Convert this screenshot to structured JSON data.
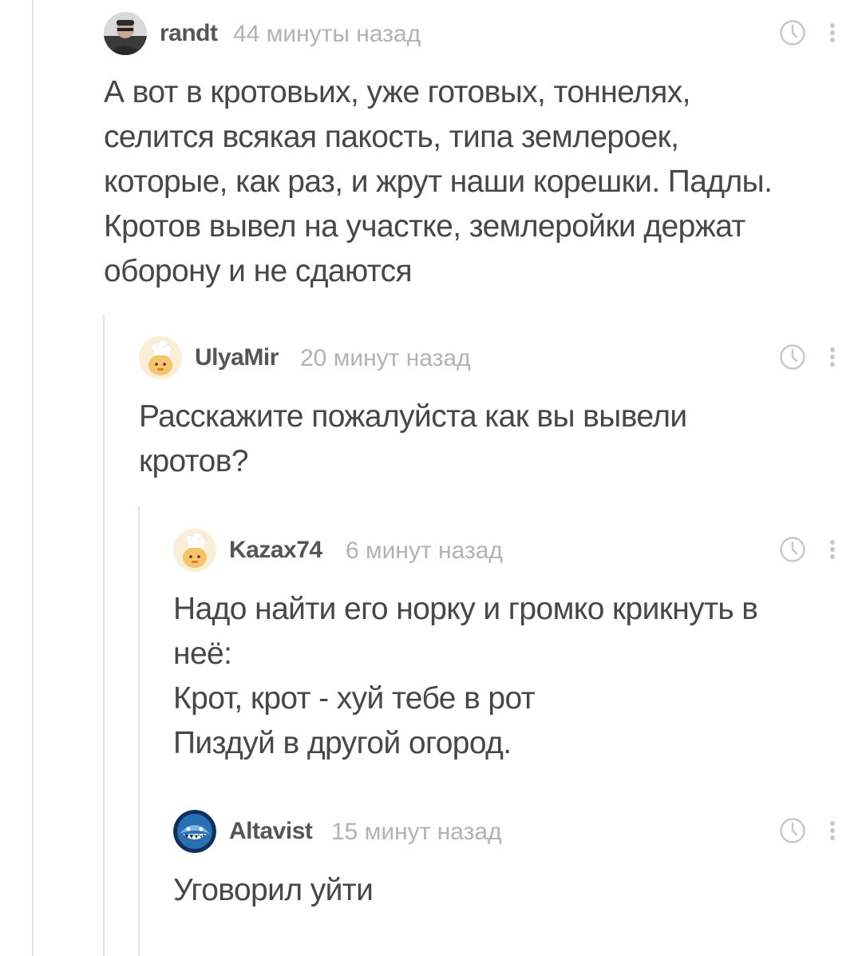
{
  "comments": [
    {
      "author": "randt",
      "time": "44 минуты назад",
      "avatar": "user-photo-avatar",
      "lines": [
        "А вот в кротовьих, уже готовых, тоннелях,",
        "селится всякая пакость, типа землероек,",
        "которые, как раз, и жрут наши корешки. Падлы.",
        "Кротов вывел на участке, землеройки держат",
        "оборону и не сдаются"
      ]
    },
    {
      "author": "UlyaMir",
      "time": "20 минут назад",
      "avatar": "default-chef-avatar",
      "lines": [
        "Расскажите пожалуйста как вы вывели",
        "кротов?"
      ]
    },
    {
      "author": "Kazax74",
      "time": "6 минут назад",
      "avatar": "default-chef-avatar",
      "lines": [
        "Надо найти его норку и громко крикнуть в",
        "неё:",
        "Крот, крот - хуй тебе в рот",
        "Пиздуй в другой огород."
      ]
    },
    {
      "author": "Altavist",
      "time": "15 минут назад",
      "avatar": "shark-avatar",
      "lines": [
        "Уговорил уйти"
      ]
    }
  ],
  "icons": {
    "clock": "clock-icon",
    "menu": "more-vertical-icon"
  },
  "colors": {
    "author": "#555555",
    "time": "#b2b2b2",
    "text": "#474747",
    "thread_line": "#e4e4e4",
    "icon": "#c8c8c8"
  }
}
